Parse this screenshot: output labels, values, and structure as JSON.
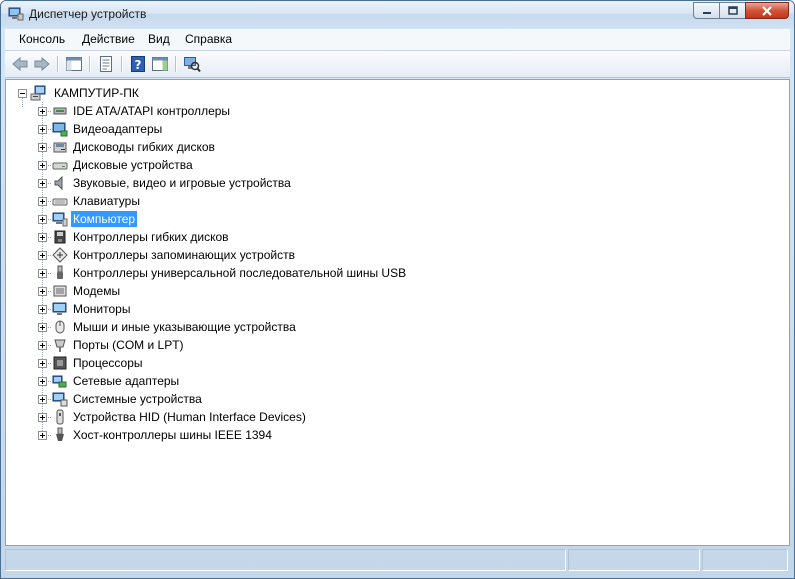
{
  "window": {
    "title": "Диспетчер устройств"
  },
  "menu": [
    "Консоль",
    "Действие",
    "Вид",
    "Справка"
  ],
  "tree": {
    "root": "КАМПУТИР-ПК",
    "items": [
      {
        "label": "IDE ATA/ATAPI контроллеры",
        "icon": "ide-controller-icon"
      },
      {
        "label": "Видеоадаптеры",
        "icon": "display-adapter-icon"
      },
      {
        "label": "Дисководы гибких дисков",
        "icon": "floppy-drive-icon"
      },
      {
        "label": "Дисковые устройства",
        "icon": "disk-drive-icon"
      },
      {
        "label": "Звуковые, видео и игровые устройства",
        "icon": "speaker-icon"
      },
      {
        "label": "Клавиатуры",
        "icon": "keyboard-icon"
      },
      {
        "label": "Компьютер",
        "icon": "computer-icon",
        "selected": true
      },
      {
        "label": "Контроллеры гибких дисков",
        "icon": "floppy-controller-icon"
      },
      {
        "label": "Контроллеры запоминающих устройств",
        "icon": "storage-controller-icon"
      },
      {
        "label": "Контроллеры универсальной последовательной шины USB",
        "icon": "usb-icon"
      },
      {
        "label": "Модемы",
        "icon": "modem-icon"
      },
      {
        "label": "Мониторы",
        "icon": "monitor-icon"
      },
      {
        "label": "Мыши и иные указывающие устройства",
        "icon": "mouse-icon"
      },
      {
        "label": "Порты (COM и LPT)",
        "icon": "port-icon"
      },
      {
        "label": "Процессоры",
        "icon": "processor-icon"
      },
      {
        "label": "Сетевые адаптеры",
        "icon": "network-adapter-icon"
      },
      {
        "label": "Системные устройства",
        "icon": "system-devices-icon"
      },
      {
        "label": "Устройства HID (Human Interface Devices)",
        "icon": "hid-icon"
      },
      {
        "label": "Хост-контроллеры шины IEEE 1394",
        "icon": "ieee1394-icon"
      }
    ]
  },
  "colors": {
    "selection": "#3399ff",
    "titlebar": "#d7e6f5",
    "close": "#c4361d"
  }
}
